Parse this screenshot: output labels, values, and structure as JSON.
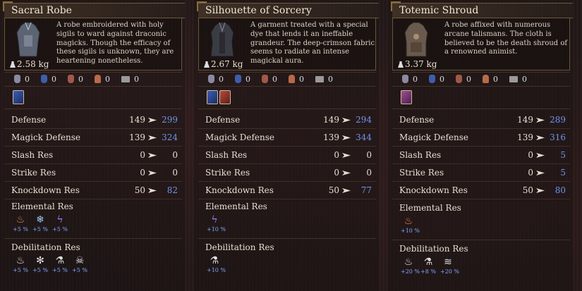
{
  "panels": [
    {
      "name": "Sacral Robe",
      "weight": "2.58 kg",
      "description": "A robe embroidered with holy sigils to ward against draconic magicks. Though the efficacy of these sigils is unknown, they are heartening nonetheless.",
      "icon_values": [
        "0",
        "0",
        "0",
        "0",
        "0"
      ],
      "crests": [
        "blue"
      ],
      "stats": [
        {
          "label": "Defense",
          "old": "149",
          "new": "299",
          "up": true
        },
        {
          "label": "Magick Defense",
          "old": "139",
          "new": "324",
          "up": true
        },
        {
          "label": "Slash Res",
          "old": "0",
          "new": "0",
          "up": false
        },
        {
          "label": "Strike Res",
          "old": "0",
          "new": "0",
          "up": false
        },
        {
          "label": "Knockdown Res",
          "old": "50",
          "new": "82",
          "up": true
        }
      ],
      "elemental_title": "Elemental Res",
      "elemental": [
        {
          "icon": "fire-icon",
          "value": "+5 %"
        },
        {
          "icon": "ice-icon",
          "value": "+5 %"
        },
        {
          "icon": "lightning-icon",
          "value": "+5 %"
        }
      ],
      "debilitation_title": "Debilitation Res",
      "debilitation": [
        {
          "icon": "burn-icon",
          "value": "+5 %"
        },
        {
          "icon": "freeze-icon",
          "value": "+5 %"
        },
        {
          "icon": "poison-icon",
          "value": "+5 %"
        },
        {
          "icon": "skull-icon",
          "value": "+5 %"
        }
      ]
    },
    {
      "name": "Silhouette of Sorcery",
      "weight": "2.67 kg",
      "description": "A garment treated with a special dye that lends it an ineffable grandeur. The deep-crimson fabric seems to radiate an intense magickal aura.",
      "icon_values": [
        "0",
        "0",
        "0",
        "0",
        "0"
      ],
      "crests": [
        "blue",
        "red"
      ],
      "stats": [
        {
          "label": "Defense",
          "old": "149",
          "new": "294",
          "up": true
        },
        {
          "label": "Magick Defense",
          "old": "139",
          "new": "344",
          "up": true
        },
        {
          "label": "Slash Res",
          "old": "0",
          "new": "0",
          "up": false
        },
        {
          "label": "Strike Res",
          "old": "0",
          "new": "0",
          "up": false
        },
        {
          "label": "Knockdown Res",
          "old": "50",
          "new": "77",
          "up": true
        }
      ],
      "elemental_title": "Elemental Res",
      "elemental": [
        {
          "icon": "lightning-icon",
          "value": "+10 %"
        }
      ],
      "debilitation_title": "Debilitation Res",
      "debilitation": [
        {
          "icon": "poison-icon",
          "value": "+10 %"
        }
      ]
    },
    {
      "name": "Totemic Shroud",
      "weight": "3.37 kg",
      "description": "A robe affixed with numerous arcane talismans. The cloth is believed to be the death shroud of a renowned animist.",
      "icon_values": [
        "0",
        "0",
        "0",
        "0",
        "0"
      ],
      "crests": [
        "purple"
      ],
      "stats": [
        {
          "label": "Defense",
          "old": "149",
          "new": "289",
          "up": true
        },
        {
          "label": "Magick Defense",
          "old": "139",
          "new": "316",
          "up": true
        },
        {
          "label": "Slash Res",
          "old": "0",
          "new": "5",
          "up": true
        },
        {
          "label": "Strike Res",
          "old": "0",
          "new": "5",
          "up": true
        },
        {
          "label": "Knockdown Res",
          "old": "50",
          "new": "80",
          "up": true
        }
      ],
      "elemental_title": "Elemental Res",
      "elemental": [
        {
          "icon": "fire-icon",
          "value": "+10 %"
        }
      ],
      "debilitation_title": "Debilitation Res",
      "debilitation": [
        {
          "icon": "burn-icon",
          "value": "+20 %"
        },
        {
          "icon": "poison-icon",
          "value": "+8 %"
        },
        {
          "icon": "wind-icon",
          "value": "+20 %"
        }
      ]
    }
  ]
}
